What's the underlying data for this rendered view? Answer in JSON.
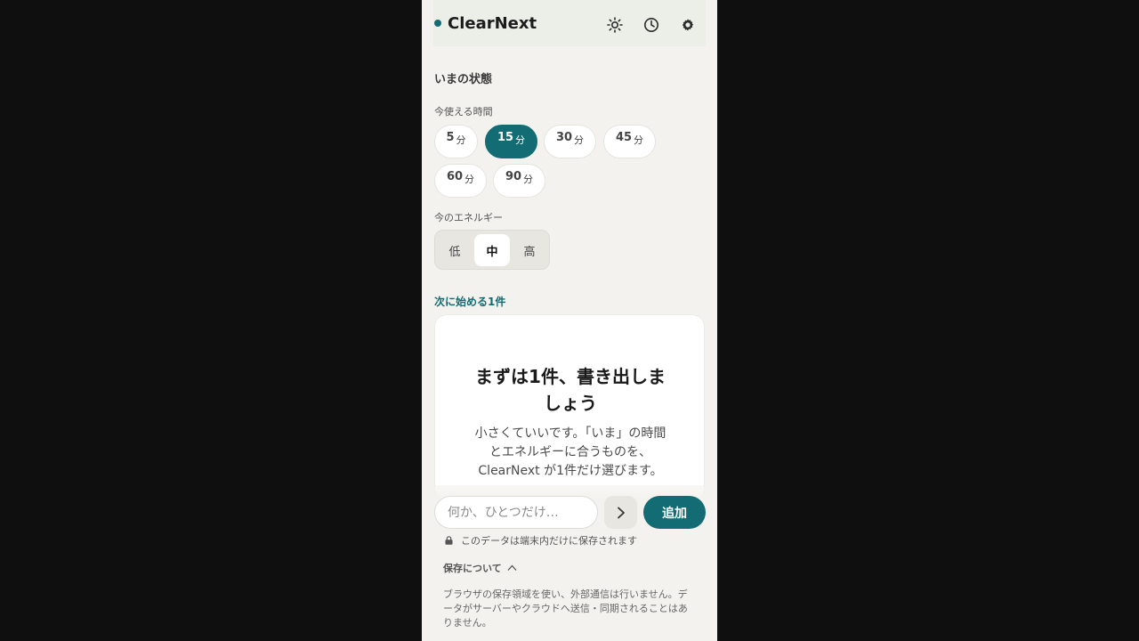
{
  "header": {
    "brand": "ClearNext",
    "icons": [
      "sun-icon",
      "history-icon",
      "gear-icon"
    ]
  },
  "status": {
    "title": "いまの状態",
    "time_label": "今使える時間",
    "time_options": [
      {
        "value": "5",
        "unit": "分"
      },
      {
        "value": "15",
        "unit": "分"
      },
      {
        "value": "30",
        "unit": "分"
      },
      {
        "value": "45",
        "unit": "分"
      },
      {
        "value": "60",
        "unit": "分"
      },
      {
        "value": "90",
        "unit": "分"
      }
    ],
    "time_selected": "15",
    "energy_label": "今のエネルギー",
    "energy_options": [
      "低",
      "中",
      "高"
    ],
    "energy_selected": "中"
  },
  "next": {
    "title": "次に始める1件",
    "card_title": "まずは1件、書き出しましょう",
    "card_body": "小さくていいです。「いま」の時間とエネルギーに合うものを、ClearNext が1件だけ選びます。"
  },
  "input": {
    "placeholder": "何か、ひとつだけ…",
    "add_label": "追加"
  },
  "privacy": {
    "note": "このデータは端末内だけに保存されます",
    "about_label": "保存について",
    "about_text": "ブラウザの保存領域を使い、外部通信は行いません。データがサーバーやクラウドへ送信・同期されることはありません。"
  },
  "colors": {
    "accent": "#136b73",
    "background": "#f3f2ee"
  }
}
